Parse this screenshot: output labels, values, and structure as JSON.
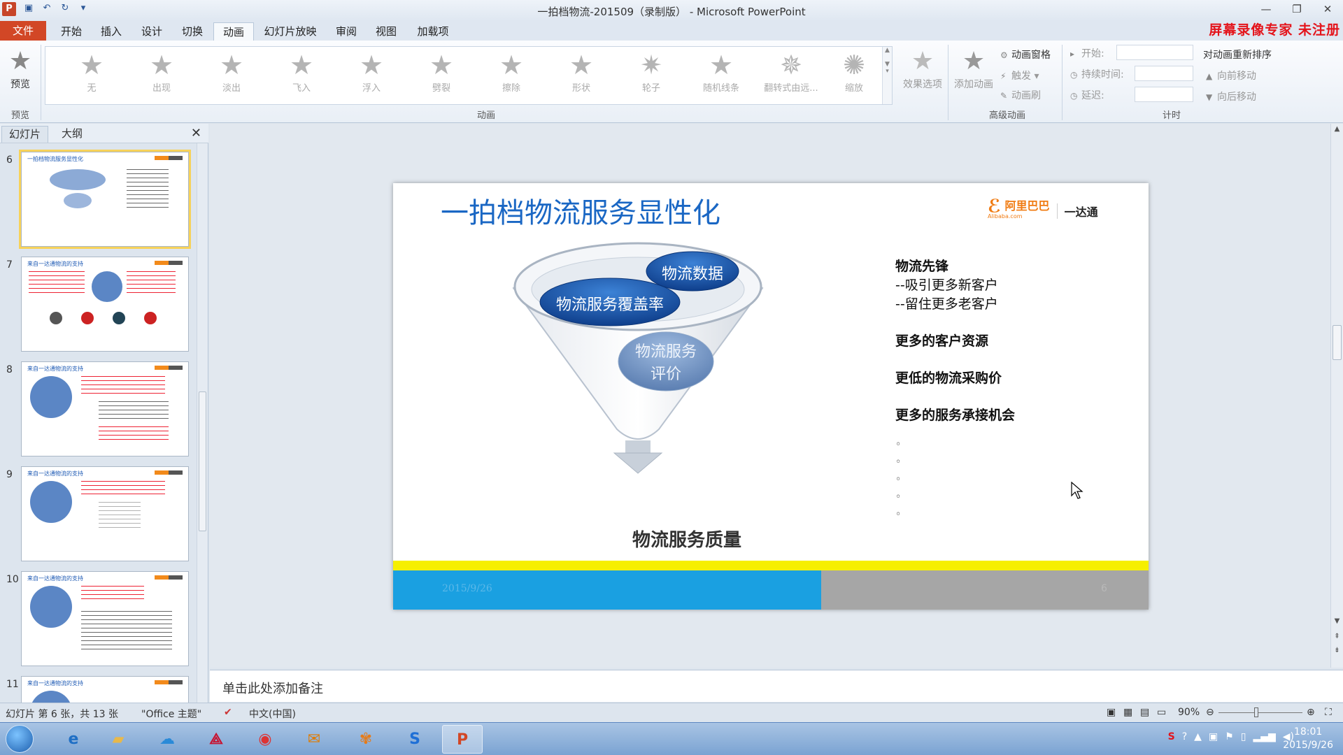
{
  "window": {
    "title": "一拍档物流-201509（录制版） - Microsoft PowerPoint",
    "app_icon": "P",
    "watermark": "屏幕录像专家 未注册"
  },
  "ribbon_tabs": [
    "文件",
    "开始",
    "插入",
    "设计",
    "切换",
    "动画",
    "幻灯片放映",
    "审阅",
    "视图",
    "加载项"
  ],
  "ribbon": {
    "preview_label": "预览",
    "preview_group": "预览",
    "animation_group": "动画",
    "advanced_group": "高级动画",
    "timing_group": "计时",
    "animations": [
      "无",
      "出现",
      "淡出",
      "飞入",
      "浮入",
      "劈裂",
      "擦除",
      "形状",
      "轮子",
      "随机线条",
      "翻转式由远...",
      "缩放"
    ],
    "effect_options": "效果选项",
    "add_animation": "添加动画",
    "animation_pane": "动画窗格",
    "trigger": "触发",
    "animation_painter": "动画刷",
    "start_label": "开始:",
    "duration_label": "持续时间:",
    "delay_label": "延迟:",
    "reorder_label": "对动画重新排序",
    "move_earlier": "向前移动",
    "move_later": "向后移动"
  },
  "left_panel": {
    "tab_slides": "幻灯片",
    "tab_outline": "大纲",
    "thumbnails": [
      {
        "num": "6",
        "title": "一拍档物流服务显性化"
      },
      {
        "num": "7",
        "title": "来自一达通物流的支持"
      },
      {
        "num": "8",
        "title": "来自一达通物流的支持"
      },
      {
        "num": "9",
        "title": "来自一达通物流的支持"
      },
      {
        "num": "10",
        "title": "来自一达通物流的支持"
      },
      {
        "num": "11",
        "title": "来自一达通物流的支持"
      }
    ]
  },
  "slide": {
    "title": "一拍档物流服务显性化",
    "logo_text": "阿里巴巴",
    "logo_sub": "Alibaba.com",
    "logo_partner": "一达通",
    "funnel": {
      "item1": "物流数据",
      "item2": "物流服务覆盖率",
      "item3_line1": "物流服务",
      "item3_line2": "评价",
      "output": "物流服务质量"
    },
    "bullets": {
      "head": "物流先锋",
      "sub1": "--吸引更多新客户",
      "sub2": "--留住更多老客户",
      "point1": "更多的客户资源",
      "point2": "更低的物流采购价",
      "point3": "更多的服务承接机会"
    },
    "footer_date": "2015/9/26",
    "footer_num": "6"
  },
  "notes_placeholder": "单击此处添加备注",
  "statusbar": {
    "slide_info": "幻灯片 第 6 张，共 13 张",
    "theme": "\"Office 主题\"",
    "language": "中文(中国)",
    "zoom": "90%"
  },
  "taskbar": {
    "time": "18:01",
    "date": "2015/9/26"
  },
  "colors": {
    "accent_file_tab": "#d24726",
    "title_blue": "#1a67c4",
    "footer_yellow": "#f6ef00",
    "footer_blue": "#1aa0e1",
    "watermark_red": "#e4141b"
  }
}
